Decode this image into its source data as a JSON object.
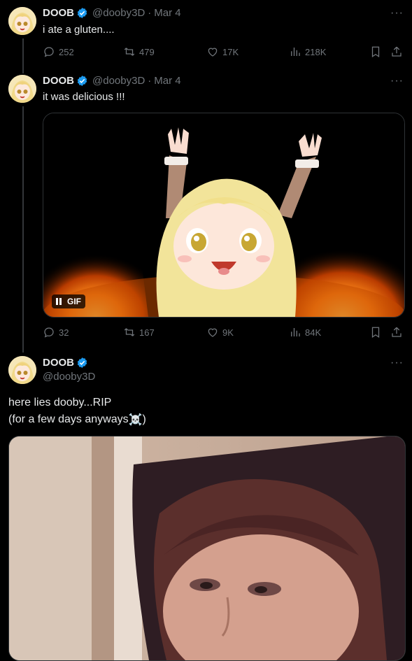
{
  "tweets": [
    {
      "name": "DOOB",
      "handle": "@dooby3D",
      "sep": "·",
      "date": "Mar 4",
      "text": "i ate a gluten....",
      "replies": "252",
      "reposts": "479",
      "likes": "17K",
      "views": "218K"
    },
    {
      "name": "DOOB",
      "handle": "@dooby3D",
      "sep": "·",
      "date": "Mar 4",
      "text": "it was delicious !!!",
      "media_badge": "GIF",
      "replies": "32",
      "reposts": "167",
      "likes": "9K",
      "views": "84K"
    },
    {
      "name": "DOOB",
      "handle": "@dooby3D",
      "text_line1": "here lies dooby...RIP",
      "text_line2": "(for a few days anyways",
      "text_line2_end": ")",
      "emoji": "☠️"
    }
  ],
  "more_label": "···",
  "colors": {
    "accent": "#1d9bf0",
    "muted": "#71767b",
    "background": "#000000",
    "text": "#e7e9ea"
  },
  "icons": [
    "reply-icon",
    "repost-icon",
    "like-icon",
    "views-icon",
    "bookmark-icon",
    "share-icon",
    "verified-icon",
    "pause-icon",
    "more-icon"
  ]
}
